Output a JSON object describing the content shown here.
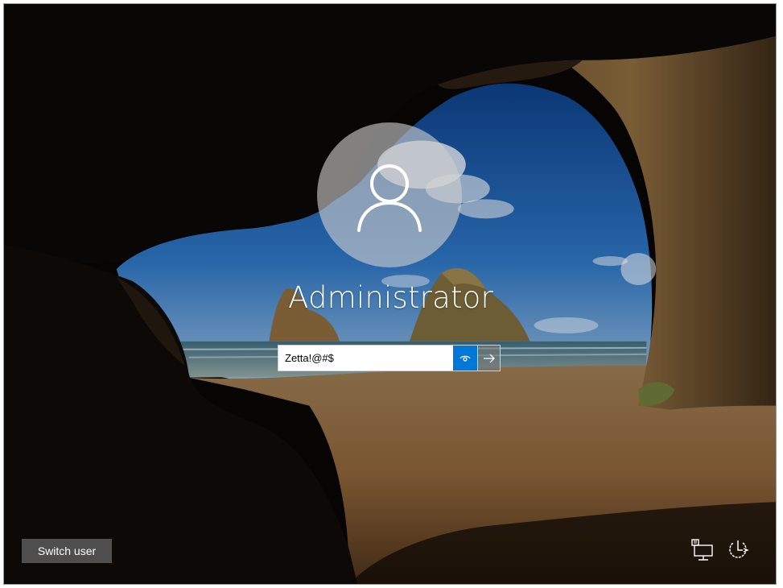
{
  "user": {
    "name": "Administrator",
    "avatar_icon": "user-silhouette-icon"
  },
  "password": {
    "value": "Zetta!@#$",
    "reveal_icon": "eye-icon",
    "submit_icon": "arrow-right-icon"
  },
  "footer": {
    "switch_user_label": "Switch user",
    "network_icon": "network-icon",
    "power_icon": "power-icon"
  },
  "colors": {
    "accent": "#0078d7",
    "text": "#ffffff"
  }
}
